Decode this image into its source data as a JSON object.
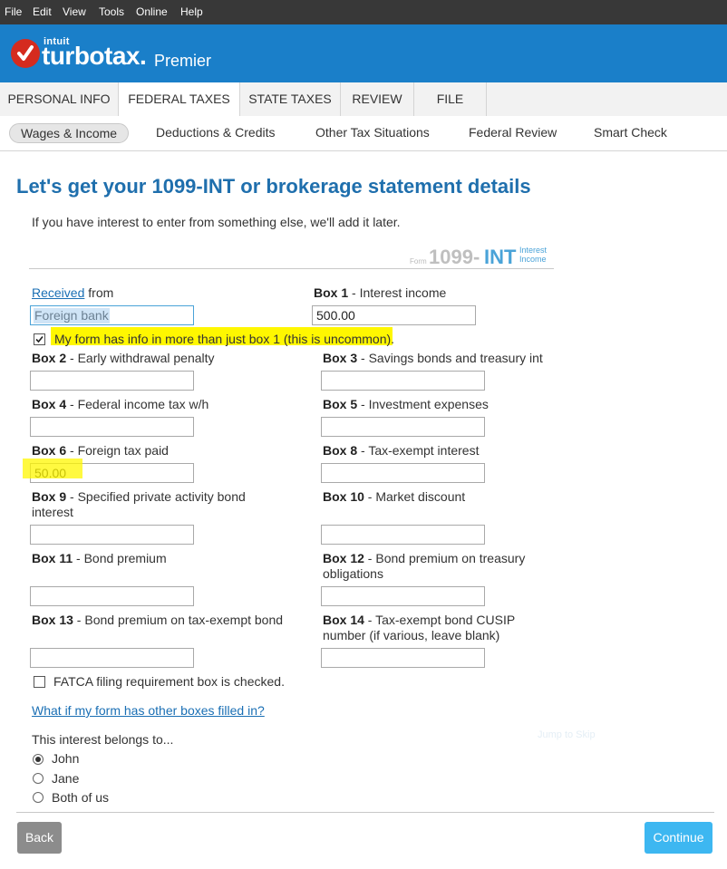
{
  "menu": [
    "File",
    "Edit",
    "View",
    "Tools",
    "Online",
    "Help"
  ],
  "header": {
    "brand_intuit": "intuit",
    "brand_name": "turbotax.",
    "edition": "Premier"
  },
  "main_tabs": [
    "PERSONAL INFO",
    "FEDERAL TAXES",
    "STATE TAXES",
    "REVIEW",
    "FILE"
  ],
  "sub_tabs": [
    "Wages & Income",
    "Deductions & Credits",
    "Other Tax Situations",
    "Federal Review",
    "Smart Check"
  ],
  "page": {
    "title": "Let's get your 1099-INT or brokerage statement details",
    "subtitle": "If you have interest to enter from something else, we'll add it later."
  },
  "badge": {
    "form": "Form",
    "num": "1099-",
    "int": "INT",
    "interest": "Interest",
    "income": "Income"
  },
  "received": {
    "link": "Received",
    "suffix": "from",
    "value": "Foreign bank"
  },
  "box1": {
    "bold": "Box 1",
    "text": " - Interest income",
    "value": "500.00"
  },
  "more_info_checkbox": "My form has info in more than just box 1 (this is uncommon).",
  "boxes": {
    "b2": {
      "bold": "Box 2",
      "text": " - Early withdrawal penalty",
      "value": ""
    },
    "b3": {
      "bold": "Box 3",
      "text": " - Savings bonds and treasury int",
      "value": ""
    },
    "b4": {
      "bold": "Box 4",
      "text": " - Federal income tax w/h",
      "value": ""
    },
    "b5": {
      "bold": "Box 5",
      "text": " - Investment expenses",
      "value": ""
    },
    "b6": {
      "bold": "Box 6",
      "text": " - Foreign tax paid",
      "value": "50.00"
    },
    "b8": {
      "bold": "Box 8",
      "text": " - Tax-exempt interest",
      "value": ""
    },
    "b9": {
      "bold": "Box 9",
      "text": " - Specified private activity bond interest",
      "value": ""
    },
    "b10": {
      "bold": "Box 10",
      "text": " - Market discount",
      "value": ""
    },
    "b11": {
      "bold": "Box 11",
      "text": " - Bond premium",
      "value": ""
    },
    "b12": {
      "bold": "Box 12",
      "text": " - Bond premium on treasury obligations",
      "value": ""
    },
    "b13": {
      "bold": "Box 13",
      "text": " - Bond premium on tax-exempt bond",
      "value": ""
    },
    "b14": {
      "bold": "Box 14",
      "text": " - Tax-exempt bond CUSIP number (if various, leave blank)",
      "value": ""
    }
  },
  "fatca": "FATCA filing requirement box is checked.",
  "other_boxes_link": "What if my form has other boxes filled in?",
  "belongs": {
    "question": "This interest belongs to...",
    "options": [
      "John",
      "Jane",
      "Both of us"
    ],
    "selected": "John"
  },
  "faint_text": "Jump to Skip",
  "buttons": {
    "back": "Back",
    "continue": "Continue"
  }
}
